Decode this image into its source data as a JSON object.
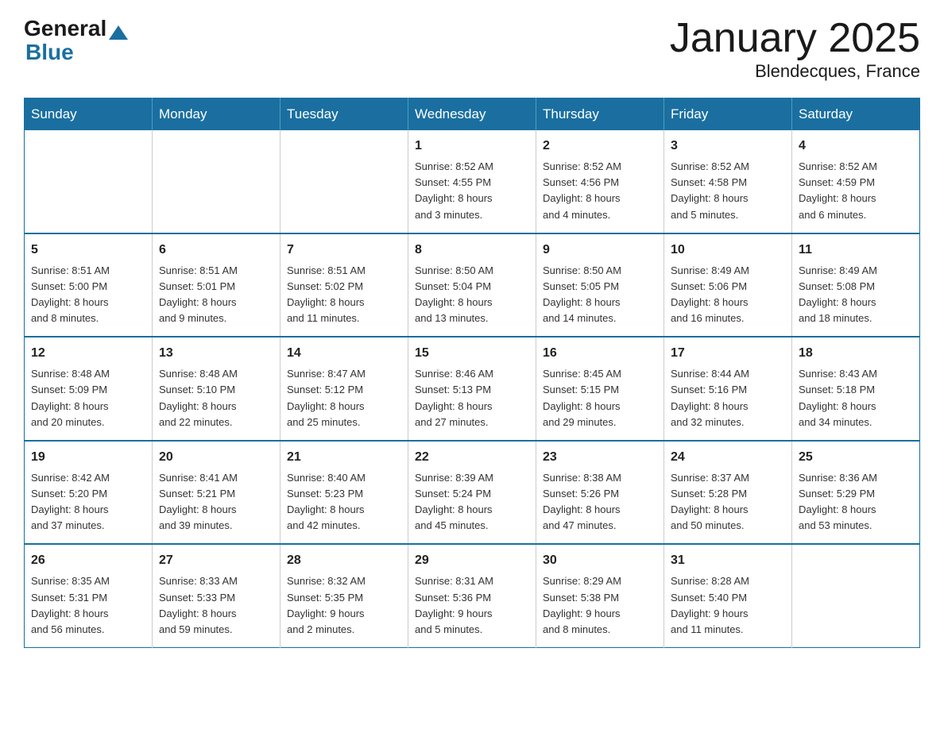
{
  "logo": {
    "general": "General",
    "triangle_color": "#1a6fa0",
    "blue": "Blue"
  },
  "header": {
    "title": "January 2025",
    "subtitle": "Blendecques, France"
  },
  "calendar": {
    "days_of_week": [
      "Sunday",
      "Monday",
      "Tuesday",
      "Wednesday",
      "Thursday",
      "Friday",
      "Saturday"
    ],
    "weeks": [
      [
        {
          "day": "",
          "info": ""
        },
        {
          "day": "",
          "info": ""
        },
        {
          "day": "",
          "info": ""
        },
        {
          "day": "1",
          "info": "Sunrise: 8:52 AM\nSunset: 4:55 PM\nDaylight: 8 hours\nand 3 minutes."
        },
        {
          "day": "2",
          "info": "Sunrise: 8:52 AM\nSunset: 4:56 PM\nDaylight: 8 hours\nand 4 minutes."
        },
        {
          "day": "3",
          "info": "Sunrise: 8:52 AM\nSunset: 4:58 PM\nDaylight: 8 hours\nand 5 minutes."
        },
        {
          "day": "4",
          "info": "Sunrise: 8:52 AM\nSunset: 4:59 PM\nDaylight: 8 hours\nand 6 minutes."
        }
      ],
      [
        {
          "day": "5",
          "info": "Sunrise: 8:51 AM\nSunset: 5:00 PM\nDaylight: 8 hours\nand 8 minutes."
        },
        {
          "day": "6",
          "info": "Sunrise: 8:51 AM\nSunset: 5:01 PM\nDaylight: 8 hours\nand 9 minutes."
        },
        {
          "day": "7",
          "info": "Sunrise: 8:51 AM\nSunset: 5:02 PM\nDaylight: 8 hours\nand 11 minutes."
        },
        {
          "day": "8",
          "info": "Sunrise: 8:50 AM\nSunset: 5:04 PM\nDaylight: 8 hours\nand 13 minutes."
        },
        {
          "day": "9",
          "info": "Sunrise: 8:50 AM\nSunset: 5:05 PM\nDaylight: 8 hours\nand 14 minutes."
        },
        {
          "day": "10",
          "info": "Sunrise: 8:49 AM\nSunset: 5:06 PM\nDaylight: 8 hours\nand 16 minutes."
        },
        {
          "day": "11",
          "info": "Sunrise: 8:49 AM\nSunset: 5:08 PM\nDaylight: 8 hours\nand 18 minutes."
        }
      ],
      [
        {
          "day": "12",
          "info": "Sunrise: 8:48 AM\nSunset: 5:09 PM\nDaylight: 8 hours\nand 20 minutes."
        },
        {
          "day": "13",
          "info": "Sunrise: 8:48 AM\nSunset: 5:10 PM\nDaylight: 8 hours\nand 22 minutes."
        },
        {
          "day": "14",
          "info": "Sunrise: 8:47 AM\nSunset: 5:12 PM\nDaylight: 8 hours\nand 25 minutes."
        },
        {
          "day": "15",
          "info": "Sunrise: 8:46 AM\nSunset: 5:13 PM\nDaylight: 8 hours\nand 27 minutes."
        },
        {
          "day": "16",
          "info": "Sunrise: 8:45 AM\nSunset: 5:15 PM\nDaylight: 8 hours\nand 29 minutes."
        },
        {
          "day": "17",
          "info": "Sunrise: 8:44 AM\nSunset: 5:16 PM\nDaylight: 8 hours\nand 32 minutes."
        },
        {
          "day": "18",
          "info": "Sunrise: 8:43 AM\nSunset: 5:18 PM\nDaylight: 8 hours\nand 34 minutes."
        }
      ],
      [
        {
          "day": "19",
          "info": "Sunrise: 8:42 AM\nSunset: 5:20 PM\nDaylight: 8 hours\nand 37 minutes."
        },
        {
          "day": "20",
          "info": "Sunrise: 8:41 AM\nSunset: 5:21 PM\nDaylight: 8 hours\nand 39 minutes."
        },
        {
          "day": "21",
          "info": "Sunrise: 8:40 AM\nSunset: 5:23 PM\nDaylight: 8 hours\nand 42 minutes."
        },
        {
          "day": "22",
          "info": "Sunrise: 8:39 AM\nSunset: 5:24 PM\nDaylight: 8 hours\nand 45 minutes."
        },
        {
          "day": "23",
          "info": "Sunrise: 8:38 AM\nSunset: 5:26 PM\nDaylight: 8 hours\nand 47 minutes."
        },
        {
          "day": "24",
          "info": "Sunrise: 8:37 AM\nSunset: 5:28 PM\nDaylight: 8 hours\nand 50 minutes."
        },
        {
          "day": "25",
          "info": "Sunrise: 8:36 AM\nSunset: 5:29 PM\nDaylight: 8 hours\nand 53 minutes."
        }
      ],
      [
        {
          "day": "26",
          "info": "Sunrise: 8:35 AM\nSunset: 5:31 PM\nDaylight: 8 hours\nand 56 minutes."
        },
        {
          "day": "27",
          "info": "Sunrise: 8:33 AM\nSunset: 5:33 PM\nDaylight: 8 hours\nand 59 minutes."
        },
        {
          "day": "28",
          "info": "Sunrise: 8:32 AM\nSunset: 5:35 PM\nDaylight: 9 hours\nand 2 minutes."
        },
        {
          "day": "29",
          "info": "Sunrise: 8:31 AM\nSunset: 5:36 PM\nDaylight: 9 hours\nand 5 minutes."
        },
        {
          "day": "30",
          "info": "Sunrise: 8:29 AM\nSunset: 5:38 PM\nDaylight: 9 hours\nand 8 minutes."
        },
        {
          "day": "31",
          "info": "Sunrise: 8:28 AM\nSunset: 5:40 PM\nDaylight: 9 hours\nand 11 minutes."
        },
        {
          "day": "",
          "info": ""
        }
      ]
    ]
  }
}
